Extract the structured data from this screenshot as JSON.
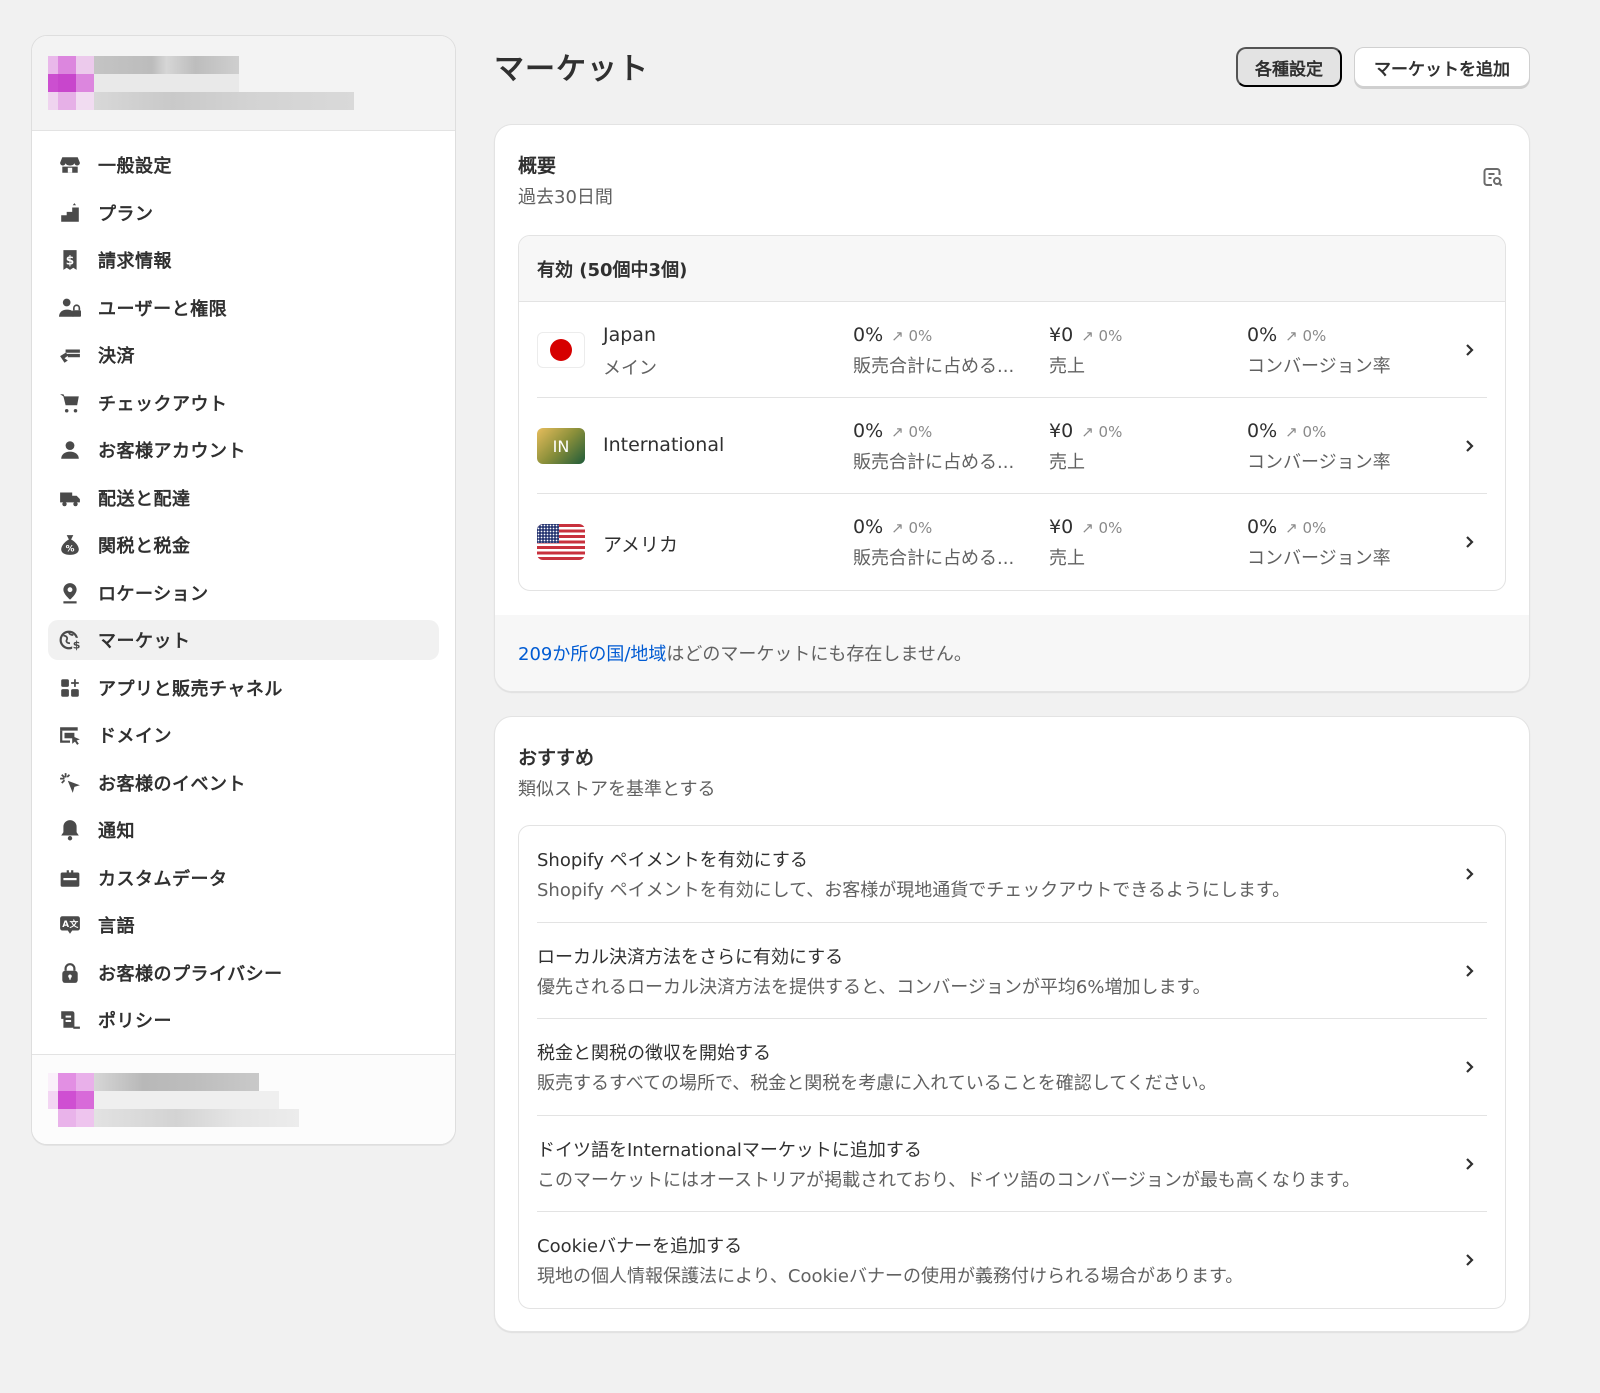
{
  "sidebar": {
    "items": [
      {
        "label": "一般設定",
        "icon": "store-icon"
      },
      {
        "label": "プラン",
        "icon": "plan-icon"
      },
      {
        "label": "請求情報",
        "icon": "receipt-icon"
      },
      {
        "label": "ユーザーと権限",
        "icon": "users-icon"
      },
      {
        "label": "決済",
        "icon": "payment-icon"
      },
      {
        "label": "チェックアウト",
        "icon": "cart-icon"
      },
      {
        "label": "お客様アカウント",
        "icon": "person-icon"
      },
      {
        "label": "配送と配達",
        "icon": "truck-icon"
      },
      {
        "label": "関税と税金",
        "icon": "tax-bag-icon"
      },
      {
        "label": "ロケーション",
        "icon": "location-pin-icon"
      },
      {
        "label": "マーケット",
        "icon": "globe-dollar-icon",
        "active": true
      },
      {
        "label": "アプリと販売チャネル",
        "icon": "apps-icon"
      },
      {
        "label": "ドメイン",
        "icon": "domain-icon"
      },
      {
        "label": "お客様のイベント",
        "icon": "cursor-click-icon"
      },
      {
        "label": "通知",
        "icon": "bell-icon"
      },
      {
        "label": "カスタムデータ",
        "icon": "custom-data-icon"
      },
      {
        "label": "言語",
        "icon": "language-icon"
      },
      {
        "label": "お客様のプライバシー",
        "icon": "lock-icon"
      },
      {
        "label": "ポリシー",
        "icon": "policy-icon"
      }
    ]
  },
  "header": {
    "title": "マーケット",
    "settings_button": "各種設定",
    "add_market_button": "マーケットを追加"
  },
  "overview": {
    "title": "概要",
    "subtitle": "過去30日間",
    "active_label": "有効 (50個中3個)",
    "markets": [
      {
        "name": "Japan",
        "subtitle": "メイン",
        "flag": "jp",
        "share": "0%",
        "share_delta": "0%",
        "share_label": "販売合計に占める...",
        "sales": "¥0",
        "sales_delta": "0%",
        "sales_label": "売上",
        "conversion": "0%",
        "conversion_delta": "0%",
        "conversion_label": "コンバージョン率"
      },
      {
        "name": "International",
        "subtitle": "",
        "flag": "in",
        "flag_text": "IN",
        "share": "0%",
        "share_delta": "0%",
        "share_label": "販売合計に占める...",
        "sales": "¥0",
        "sales_delta": "0%",
        "sales_label": "売上",
        "conversion": "0%",
        "conversion_delta": "0%",
        "conversion_label": "コンバージョン率"
      },
      {
        "name": "アメリカ",
        "subtitle": "",
        "flag": "us",
        "share": "0%",
        "share_delta": "0%",
        "share_label": "販売合計に占める...",
        "sales": "¥0",
        "sales_delta": "0%",
        "sales_label": "売上",
        "conversion": "0%",
        "conversion_delta": "0%",
        "conversion_label": "コンバージョン率"
      }
    ],
    "footer_link": "209か所の国/地域",
    "footer_text": "はどのマーケットにも存在しません。"
  },
  "recommendations": {
    "title": "おすすめ",
    "subtitle": "類似ストアを基準とする",
    "items": [
      {
        "title": "Shopify ペイメントを有効にする",
        "description": "Shopify ペイメントを有効にして、お客様が現地通貨でチェックアウトできるようにします。"
      },
      {
        "title": "ローカル決済方法をさらに有効にする",
        "description": "優先されるローカル決済方法を提供すると、コンバージョンが平均6%増加します。"
      },
      {
        "title": "税金と関税の徴収を開始する",
        "description": "販売するすべての場所で、税金と関税を考慮に入れていることを確認してください。"
      },
      {
        "title": "ドイツ語をInternationalマーケットに追加する",
        "description": "このマーケットにはオーストリアが掲載されており、ドイツ語のコンバージョンが最も高くなります。"
      },
      {
        "title": "Cookieバナーを追加する",
        "description": "現地の個人情報保護法により、Cookieバナーの使用が義務付けられる場合があります。"
      }
    ]
  },
  "colors": {
    "link": "#005bd3",
    "active_nav_bg": "#f1f1f1",
    "page_bg": "#f1f1f1",
    "avatar_accent": "#cc4fd0"
  }
}
